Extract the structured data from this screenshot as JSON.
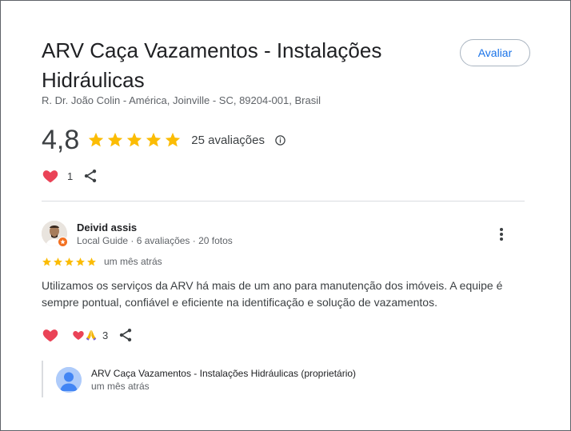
{
  "business": {
    "title": "ARV Caça Vazamentos - Instalações Hidráulicas",
    "address": "R. Dr. João Colin - América, Joinville - SC, 89204-001, Brasil",
    "rate_button": "Avaliar",
    "rating": "4,8",
    "stars": 5,
    "review_count": "25 avaliações",
    "likes": "1"
  },
  "review": {
    "author": "Deivid assis",
    "meta": "Local Guide · 6 avaliações · 20 fotos",
    "stars": 5,
    "date": "um mês atrás",
    "text": "Utilizamos os serviços da ARV há mais de um ano para manutenção dos imóveis. A equipe é sempre pontual, confiável e eficiente na identificação e solução de vazamentos.",
    "reaction_count": "3"
  },
  "owner_reply": {
    "name": "ARV Caça Vazamentos - Instalações Hidráulicas (proprietário)",
    "date": "um mês atrás"
  },
  "colors": {
    "star": "#fbbc04",
    "heart": "#ea4357",
    "link": "#1a73e8",
    "guide_badge": "#f37020"
  },
  "icons": [
    "star-icon",
    "info-icon",
    "heart-icon",
    "share-icon",
    "more-vert-icon",
    "praying-hands-icon",
    "person-icon"
  ]
}
